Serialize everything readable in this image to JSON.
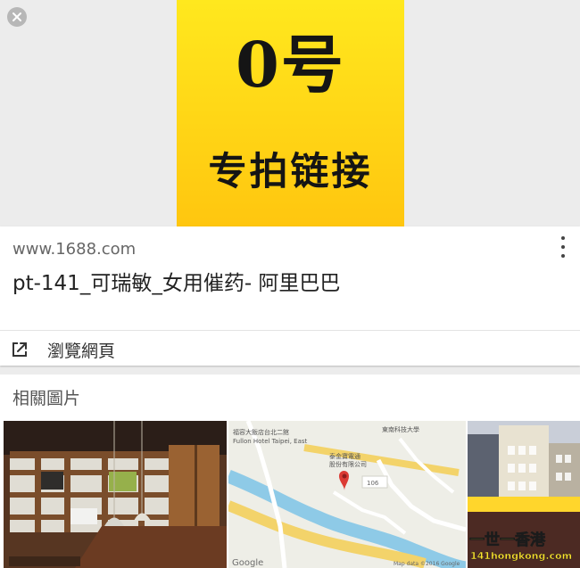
{
  "preview": {
    "number_text": "0号",
    "caption_text": "专拍链接"
  },
  "result": {
    "domain": "www.1688.com",
    "title": "pt-141_可瑞敏_女用催药- 阿里巴巴",
    "visit_label": "瀏覽網頁"
  },
  "related": {
    "heading": "相關圖片",
    "map": {
      "labels": [
        "福容大飯店台北二館",
        "Fullon Hotel Taipei, East",
        "東南科技大學",
        "泰金寶電通",
        "股份有限公司",
        "106"
      ],
      "google_label": "Google",
      "attribution": "Map data ©2016 Google"
    },
    "street": {
      "overlay_text": "一世一香港",
      "overlay_url": "141hongkong.com"
    }
  },
  "colors": {
    "preview_yellow": "#ffd81c",
    "map_road_yellow": "#f3d36a",
    "map_river_blue": "#8ecae7",
    "pin_red": "#db3a34"
  }
}
